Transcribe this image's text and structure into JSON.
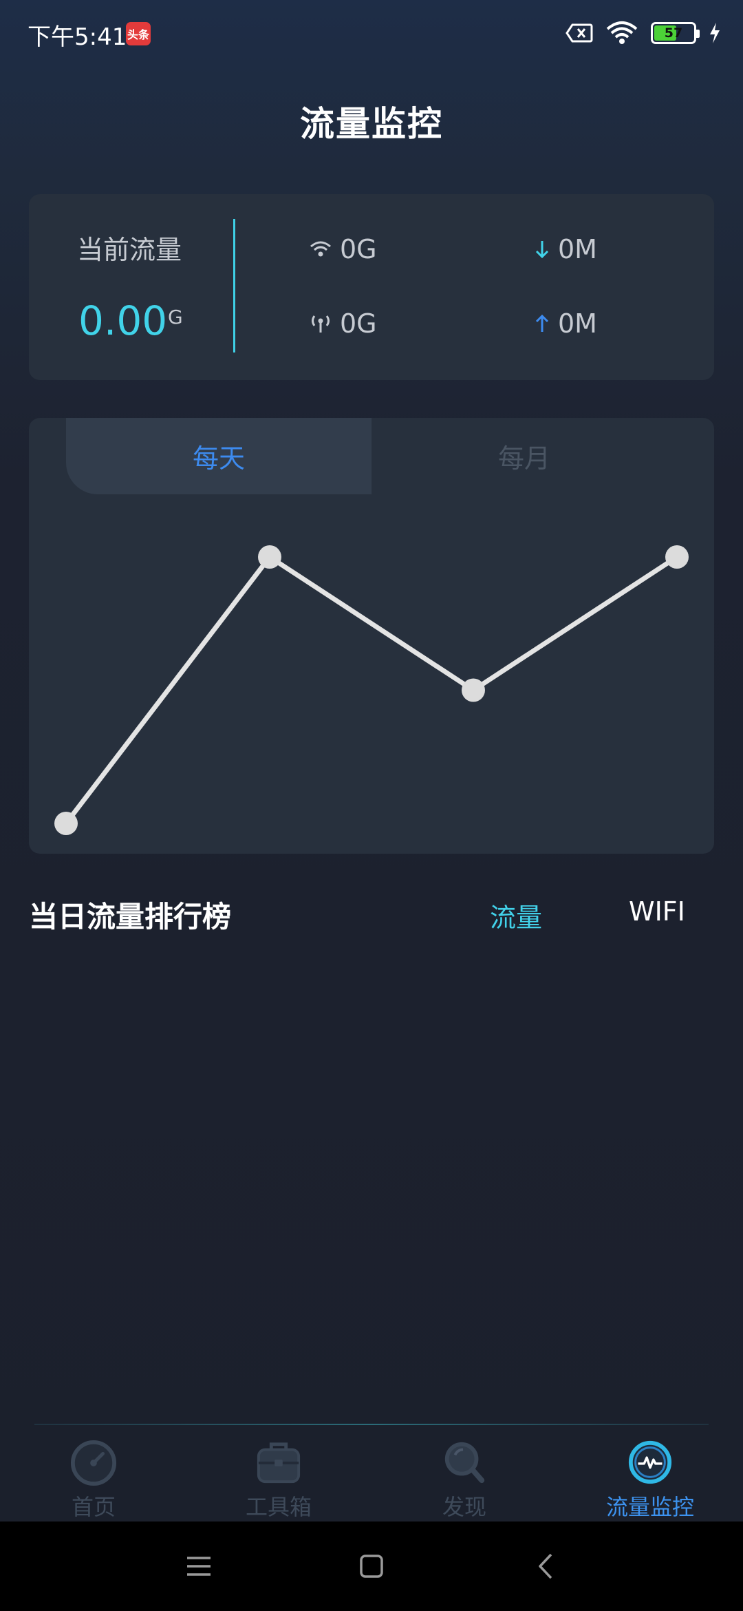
{
  "status_bar": {
    "time": "下午5:41",
    "app_badge": "头条",
    "battery_level": "57",
    "battery_percent": 0.57,
    "icons": [
      "no-sim-icon",
      "wifi-icon",
      "battery-icon",
      "charging-bolt-icon"
    ]
  },
  "page_title": "流量监控",
  "summary": {
    "current_label": "当前流量",
    "current_value": "0.00",
    "current_unit": "G",
    "wifi_usage": "0G",
    "mobile_usage": "0G",
    "download": "0M",
    "upload": "0M"
  },
  "chart_tabs": {
    "daily": "每天",
    "monthly": "每月",
    "selected": "daily"
  },
  "chart_data": {
    "type": "line",
    "x": [
      1,
      2,
      3,
      4
    ],
    "values": [
      0,
      1,
      0.5,
      1
    ],
    "ylim": [
      0,
      1
    ],
    "grid": false,
    "line_color": "#e4e4e4",
    "point_color": "#dcdcdc"
  },
  "ranking": {
    "title": "当日流量排行榜",
    "tab_traffic": "流量",
    "tab_wifi": "WIFI",
    "selected": "traffic",
    "items": []
  },
  "bottom_nav": [
    {
      "label": "首页",
      "icon": "speedometer-icon",
      "active": false
    },
    {
      "label": "工具箱",
      "icon": "toolbox-icon",
      "active": false
    },
    {
      "label": "发现",
      "icon": "search-icon",
      "active": false
    },
    {
      "label": "流量监控",
      "icon": "pulse-monitor-icon",
      "active": true
    }
  ],
  "colors": {
    "accent_cyan": "#41d3e9",
    "accent_blue": "#3d8bef",
    "card_bg": "#27303d",
    "inactive": "#3e4a5a"
  }
}
